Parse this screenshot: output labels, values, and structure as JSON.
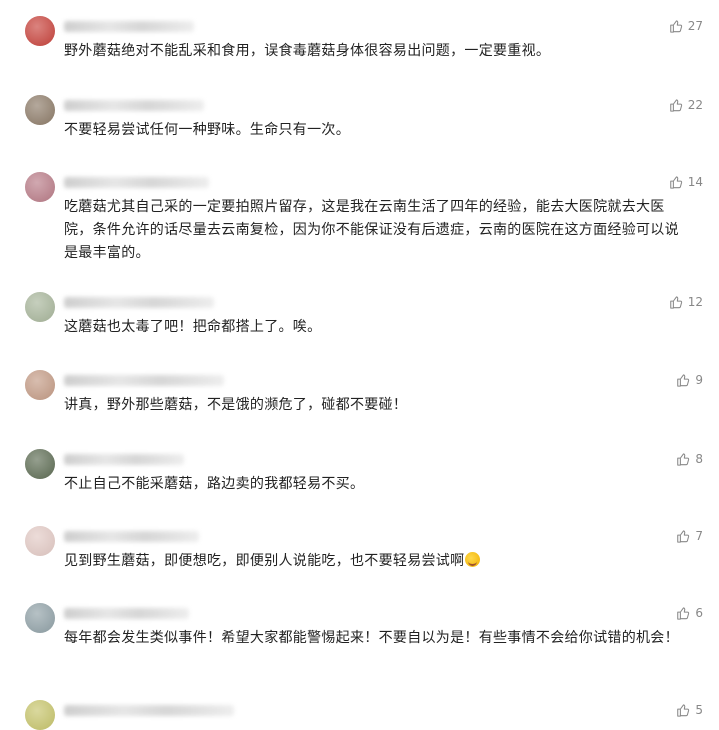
{
  "comments": [
    {
      "text": "野外蘑菇绝对不能乱采和食用，误食毒蘑菇身体很容易出问题，一定要重视。",
      "likes": "27",
      "avatar_color": "#c7413a"
    },
    {
      "text": "不要轻易尝试任何一种野味。生命只有一次。",
      "likes": "22",
      "avatar_color": "#8c7a67"
    },
    {
      "text": "吃蘑菇尤其自己采的一定要拍照片留存，这是我在云南生活了四年的经验，能去大医院就去大医院，条件允许的话尽量去云南复检，因为你不能保证没有后遗症，云南的医院在这方面经验可以说是最丰富的。",
      "likes": "14",
      "avatar_color": "#b87a86"
    },
    {
      "text": "这蘑菇也太毒了吧！把命都搭上了。唉。",
      "likes": "12",
      "avatar_color": "#a7b59a"
    },
    {
      "text": "讲真，野外那些蘑菇，不是饿的濒危了，碰都不要碰！",
      "likes": "9",
      "avatar_color": "#c39a84"
    },
    {
      "text": "不止自己不能采蘑菇，路边卖的我都轻易不买。",
      "likes": "8",
      "avatar_color": "#5c6b52"
    },
    {
      "text": "见到野生蘑菇，即便想吃，即便别人说能吃，也不要轻易尝试啊",
      "likes": "7",
      "avatar_color": "#e2c9c4",
      "emoji": true
    },
    {
      "text": "每年都会发生类似事件！希望大家都能警惕起来！不要自以为是！有些事情不会给你试错的机会！",
      "likes": "6",
      "avatar_color": "#8fa0a6"
    },
    {
      "text": "",
      "likes": "5",
      "avatar_color": "#c6c46a"
    }
  ]
}
